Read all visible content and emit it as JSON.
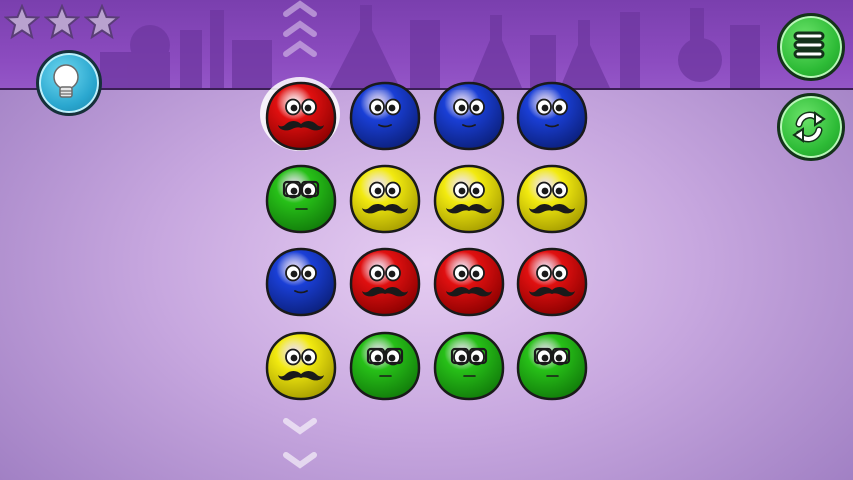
{
  "hud": {
    "stars_total": 3,
    "stars_earned": 0
  },
  "buttons": {
    "hint_icon": "lightbulb-icon",
    "menu_icon": "hamburger-menu-icon",
    "restart_icon": "restart-arrows-icon"
  },
  "board": {
    "selected": {
      "row": 0,
      "col": 0
    },
    "rows": [
      [
        {
          "color": "red",
          "face": "mustache"
        },
        {
          "color": "blue",
          "face": "plain"
        },
        {
          "color": "blue",
          "face": "plain"
        },
        {
          "color": "blue",
          "face": "plain"
        }
      ],
      [
        {
          "color": "green",
          "face": "glasses"
        },
        {
          "color": "yellow",
          "face": "mustache"
        },
        {
          "color": "yellow",
          "face": "mustache"
        },
        {
          "color": "yellow",
          "face": "mustache"
        }
      ],
      [
        {
          "color": "blue",
          "face": "plain"
        },
        {
          "color": "red",
          "face": "mustache"
        },
        {
          "color": "red",
          "face": "mustache"
        },
        {
          "color": "red",
          "face": "mustache"
        }
      ],
      [
        {
          "color": "yellow",
          "face": "mustache"
        },
        {
          "color": "green",
          "face": "glasses"
        },
        {
          "color": "green",
          "face": "glasses"
        },
        {
          "color": "green",
          "face": "glasses"
        }
      ]
    ]
  },
  "colors": {
    "red": "#e01010",
    "blue": "#1a3fd6",
    "green": "#27c018",
    "yellow": "#f2ea10",
    "topbar": "#8a4bbf",
    "star_empty": "#a98cc4",
    "button_green": "#2dbb36",
    "button_blue": "#2aa7cf"
  }
}
